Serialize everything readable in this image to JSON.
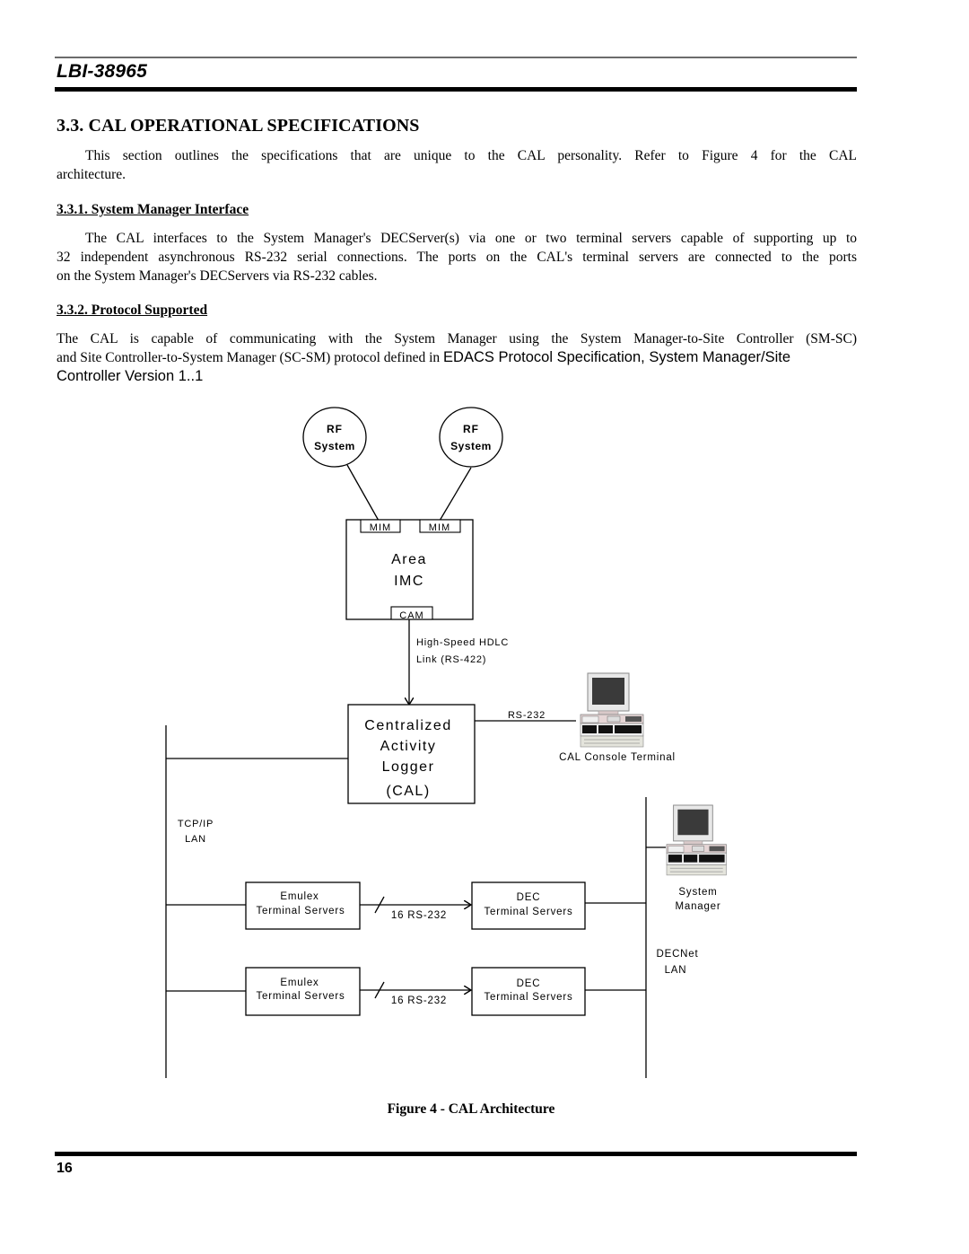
{
  "header": {
    "doc_id": "LBI-38965"
  },
  "section": {
    "title": "3.3.  CAL OPERATIONAL SPECIFICATIONS",
    "intro_line1": "This section outlines the specifications that are unique to the CAL personality.  Refer to Figure 4 for the CAL",
    "intro_line2": "architecture."
  },
  "subsections": [
    {
      "title": "3.3.1.  System Manager Interface",
      "lines": [
        "The CAL interfaces to the System Manager's DECServer(s) via one or two terminal servers capable of supporting up to",
        "32 independent asynchronous RS-232 serial connections.  The ports on the CAL's terminal servers are connected to the ports",
        "on the System Manager's DECServers via RS-232 cables."
      ]
    },
    {
      "title": "3.3.2.  Protocol Supported",
      "line1": "The CAL is capable of communicating with the System Manager using the System Manager-to-Site Controller (SM-SC)",
      "line2_serif": "and Site Controller-to-System Manager (SC-SM) protocol defined in ",
      "line2_sans": "EDACS Protocol Specification, System Manager/Site",
      "line3_sans": "Controller Version 1..1"
    }
  ],
  "diagram": {
    "rf_system_1": {
      "line1": "RF",
      "line2": "System"
    },
    "rf_system_2": {
      "line1": "RF",
      "line2": "System"
    },
    "mim_1": "MIM",
    "mim_2": "MIM",
    "area_imc": {
      "line1": "Area",
      "line2": "IMC"
    },
    "cam": "CAM",
    "hdlc_link": {
      "line1": "High-Speed HDLC",
      "line2": "Link (RS-422)"
    },
    "cal_box": {
      "line1": "Centralized",
      "line2": "Activity",
      "line3": "Logger",
      "line4": "(CAL)"
    },
    "rs232_label": "RS-232",
    "cal_console": "CAL Console Terminal",
    "tcpip_lan": {
      "line1": "TCP/IP",
      "line2": "LAN"
    },
    "emulex_1": {
      "line1": "Emulex",
      "line2": "Terminal Servers"
    },
    "emulex_2": {
      "line1": "Emulex",
      "line2": "Terminal Servers"
    },
    "link_1": "16 RS-232",
    "link_2": "16 RS-232",
    "dec_1": {
      "line1": "DEC",
      "line2": "Terminal Servers"
    },
    "dec_2": {
      "line1": "DEC",
      "line2": "Terminal Servers"
    },
    "system_manager": {
      "line1": "System",
      "line2": "Manager"
    },
    "decnet_lan": {
      "line1": "DECNet",
      "line2": "LAN"
    }
  },
  "figure_caption": "Figure 4 - CAL Architecture",
  "footer": {
    "page_number": "16"
  }
}
